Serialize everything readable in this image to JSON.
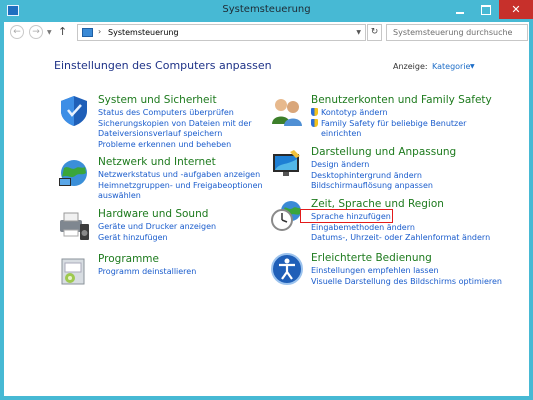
{
  "window": {
    "title": "Systemsteuerung",
    "close": "✕"
  },
  "addressbar": {
    "back": "←",
    "forward": "→",
    "dropdown": "▼",
    "up": "↑",
    "separator": "›",
    "crumb": "Systemsteuerung",
    "refresh": "↻",
    "search_placeholder": "Systemsteuerung durchsuchen"
  },
  "page": {
    "title": "Einstellungen des Computers anpassen",
    "view_label": "Anzeige:",
    "view_value": "Kategorie",
    "view_arrow": "▼"
  },
  "categories_left": [
    {
      "title": "System und Sicherheit",
      "links": [
        "Status des Computers überprüfen",
        "Sicherungskopien von Dateien mit der",
        "Dateiversionsverlauf speichern",
        "Probleme erkennen und beheben"
      ]
    },
    {
      "title": "Netzwerk und Internet",
      "links": [
        "Netzwerkstatus und -aufgaben anzeigen",
        "Heimnetzgruppen- und Freigabeoptionen",
        "auswählen"
      ]
    },
    {
      "title": "Hardware und Sound",
      "links": [
        "Geräte und Drucker anzeigen",
        "Gerät hinzufügen"
      ]
    },
    {
      "title": "Programme",
      "links": [
        "Programm deinstallieren"
      ]
    }
  ],
  "categories_right": [
    {
      "title": "Benutzerkonten und Family Safety",
      "links": [
        "Kontotyp ändern",
        "Family Safety für beliebige Benutzer",
        "einrichten"
      ]
    },
    {
      "title": "Darstellung und Anpassung",
      "links": [
        "Design ändern",
        "Desktophintergrund ändern",
        "Bildschirmauflösung anpassen"
      ]
    },
    {
      "title": "Zeit, Sprache und Region",
      "links": [
        "Sprache hinzufügen",
        "Eingabemethoden ändern",
        "Datums-, Uhrzeit- oder Zahlenformat ändern"
      ]
    },
    {
      "title": "Erleichterte Bedienung",
      "links": [
        "Einstellungen empfehlen lassen",
        "Visuelle Darstellung des Bildschirms optimieren"
      ]
    }
  ]
}
